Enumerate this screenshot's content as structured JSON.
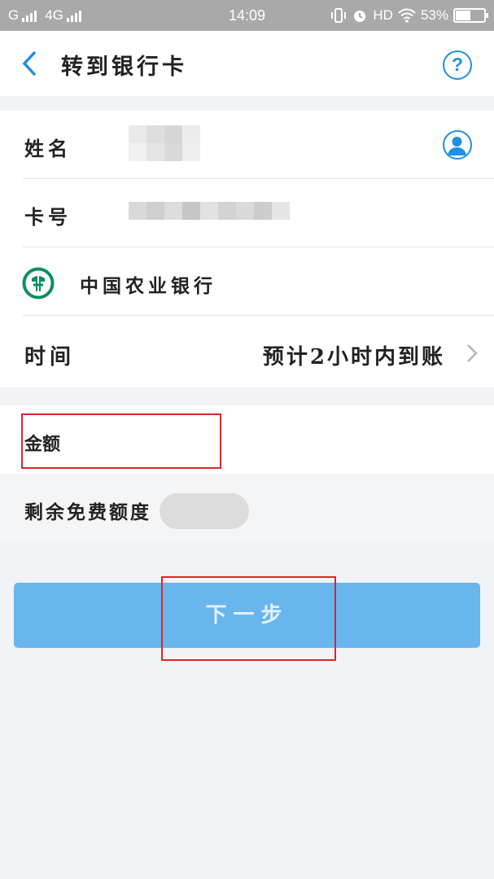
{
  "status_bar": {
    "carrier1": "G",
    "carrier2": "4G",
    "time": "14:09",
    "hd": "HD",
    "battery_percent": "53%",
    "battery_level": 0.53
  },
  "nav": {
    "title": "转到银行卡",
    "back_icon": "chevron-left-icon",
    "help_icon": "question-circle-icon"
  },
  "form": {
    "name_label": "姓名",
    "card_label": "卡号",
    "bank_name": "中国农业银行",
    "time_label": "时间",
    "time_value": "预计2小时内到账",
    "amount_label": "金额",
    "free_quota_label": "剩余免费额度"
  },
  "actions": {
    "next_label": "下一步"
  },
  "colors": {
    "accent": "#1e90e4",
    "button": "#69b5ee",
    "highlight_box": "#e0242a",
    "bank_green": "#0f8f62"
  }
}
